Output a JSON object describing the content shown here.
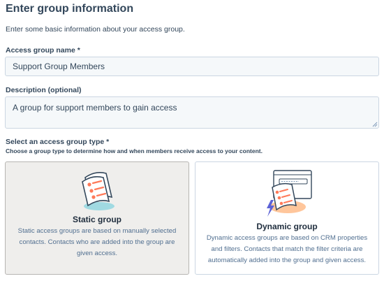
{
  "header": {
    "title": "Enter group information",
    "subtitle": "Enter some basic information about your access group."
  },
  "name_field": {
    "label": "Access group name *",
    "value": "Support Group Members"
  },
  "description_field": {
    "label": "Description (optional)",
    "value": "A group for support members to gain access"
  },
  "group_type": {
    "label": "Select an access group type *",
    "hint": "Choose a group type to determine how and when members receive access to your content.",
    "selected": "static",
    "options": [
      {
        "id": "static",
        "title": "Static group",
        "description": "Static access groups are based on manually selected contacts. Contacts who are added into the group are given access.",
        "icon": "static-list-illustration-icon"
      },
      {
        "id": "dynamic",
        "title": "Dynamic group",
        "description": "Dynamic access groups are based on CRM properties and filters. Contacts that match the filter criteria are automatically added into the group and given access.",
        "icon": "dynamic-list-illustration-icon"
      }
    ]
  },
  "colors": {
    "text": "#33475b",
    "border": "#cbd6e2",
    "input_bg": "#f5f8fa",
    "selected_card_bg": "#efeeec",
    "accent_orange": "#ff7a59",
    "accent_teal": "#7fd1de",
    "accent_blue": "#5c62d6"
  }
}
